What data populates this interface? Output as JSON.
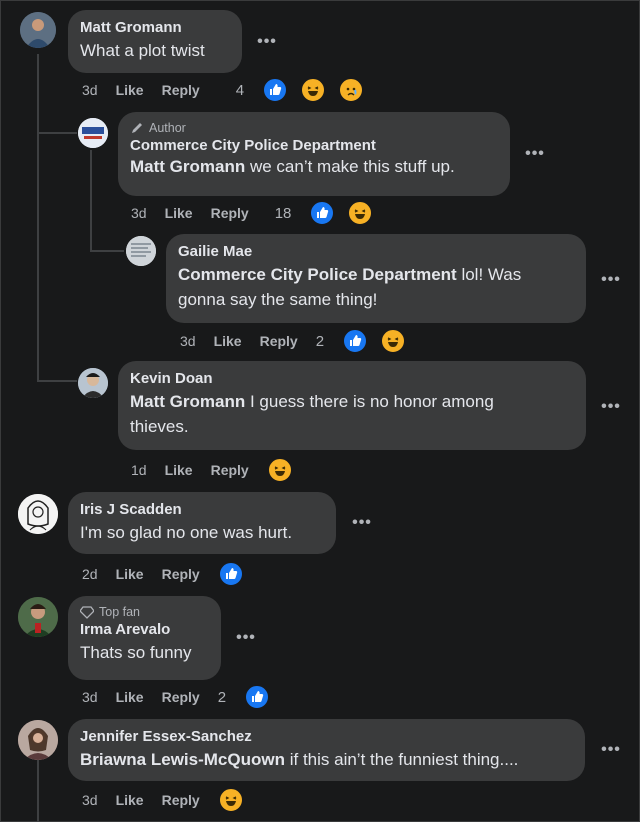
{
  "comments": [
    {
      "name": "Matt Gromann",
      "text": "What a plot twist",
      "time": "3d",
      "like": "Like",
      "reply": "Reply",
      "reaction_count": "4",
      "reactions": [
        "like-icon",
        "haha-icon",
        "sad-icon"
      ]
    },
    {
      "badge": "Author",
      "name": "Commerce City Police Department",
      "mention": "Matt Gromann",
      "text": "we can’t make this stuff up.",
      "time": "3d",
      "like": "Like",
      "reply": "Reply",
      "reaction_count": "18",
      "reactions": [
        "like-icon",
        "haha-icon"
      ]
    },
    {
      "name": "Gailie Mae",
      "mention": "Commerce City Police Department",
      "text_line1": "lol! Was",
      "text_line2": "gonna say the same thing!",
      "time": "3d",
      "like": "Like",
      "reply": "Reply",
      "reaction_count": "2",
      "reactions": [
        "like-icon",
        "haha-icon"
      ]
    },
    {
      "name": "Kevin Doan",
      "mention": "Matt Gromann",
      "text_line1": "I guess there is no honor among",
      "text_line2": "thieves.",
      "time": "1d",
      "like": "Like",
      "reply": "Reply",
      "reactions": [
        "haha-icon"
      ]
    },
    {
      "name": "Iris J Scadden",
      "text": "I'm so glad no one was hurt.",
      "time": "2d",
      "like": "Like",
      "reply": "Reply",
      "reactions": [
        "like-icon"
      ]
    },
    {
      "badge": "Top fan",
      "name": "Irma Arevalo",
      "text": "Thats so funny",
      "time": "3d",
      "like": "Like",
      "reply": "Reply",
      "reaction_count": "2",
      "reactions": [
        "like-icon"
      ]
    },
    {
      "name": "Jennifer Essex-Sanchez",
      "mention": "Briawna Lewis-McQuown",
      "text": "if this ain’t the funniest thing....",
      "time": "3d",
      "like": "Like",
      "reply": "Reply",
      "reactions": [
        "haha-icon"
      ]
    }
  ],
  "more_label": "•••",
  "colors": {
    "bg": "#18191a",
    "bubble": "#3a3b3c",
    "like_blue": "#1877f2",
    "haha_yellow": "#f7b125"
  }
}
